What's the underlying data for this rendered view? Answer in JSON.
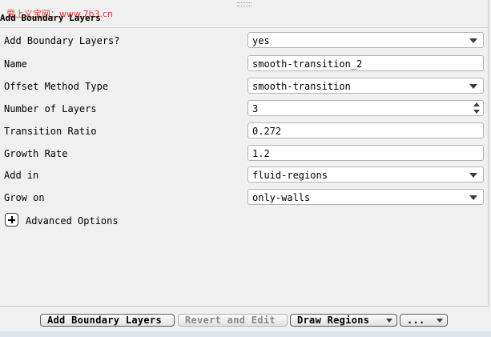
{
  "watermark": "爱上义宝网：www.7b3.cn",
  "panel": {
    "title": "Add Boundary Layers"
  },
  "rows": {
    "add_boundary_layers": {
      "label": "Add Boundary Layers?",
      "value": "yes"
    },
    "name": {
      "label": "Name",
      "value": "smooth-transition_2"
    },
    "offset_method": {
      "label": "Offset Method Type",
      "value": "smooth-transition"
    },
    "number_of_layers": {
      "label": "Number of Layers",
      "value": "3"
    },
    "transition_ratio": {
      "label": "Transition Ratio",
      "value": "0.272"
    },
    "growth_rate": {
      "label": "Growth Rate",
      "value": "1.2"
    },
    "add_in": {
      "label": "Add in",
      "value": "fluid-regions"
    },
    "grow_on": {
      "label": "Grow on",
      "value": "only-walls"
    }
  },
  "advanced": {
    "label": "Advanced Options"
  },
  "buttons": {
    "add": "Add Boundary Layers",
    "revert": "Revert and Edit",
    "draw": "Draw Regions",
    "more": "..."
  }
}
